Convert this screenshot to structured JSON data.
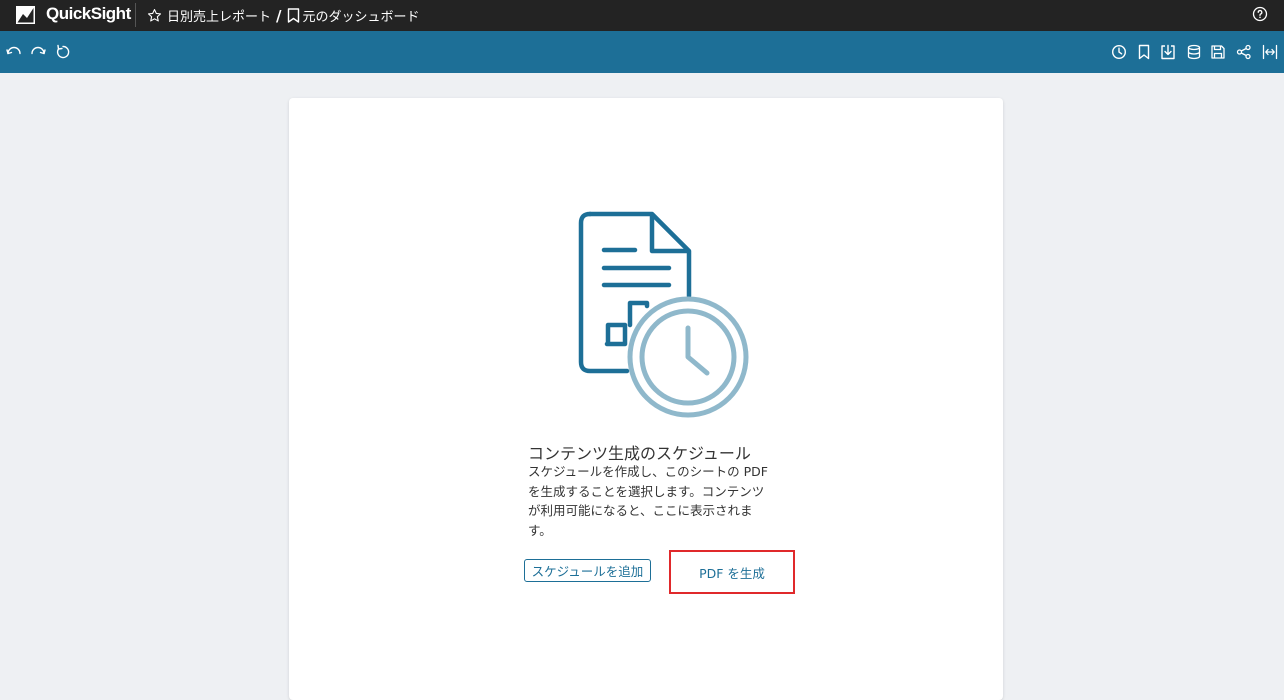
{
  "app": {
    "brand": "QuickSight"
  },
  "breadcrumb": {
    "analysis": "日別売上レポート",
    "separator": "/",
    "dashboard": "元のダッシュボード"
  },
  "toolbar": {
    "left_icons": [
      "undo-icon",
      "redo-icon",
      "reset-icon"
    ],
    "right_icons": [
      "schedule-icon",
      "bookmark-icon",
      "export-icon",
      "dataset-icon",
      "save-icon",
      "share-icon",
      "fit-width-icon"
    ]
  },
  "empty_state": {
    "title": "コンテンツ生成のスケジュール",
    "description": "スケジュールを作成し、このシートの PDF を生成することを選択します。コンテンツが利用可能になると、ここに表示されます。",
    "add_schedule_label": "スケジュールを追加",
    "generate_pdf_label": "PDF を生成"
  },
  "colors": {
    "topbar": "#232323",
    "toolbar": "#1d6f97",
    "accent": "#1d6f97",
    "highlight": "#e0292b",
    "illustration_light": "#8fb8cb"
  }
}
